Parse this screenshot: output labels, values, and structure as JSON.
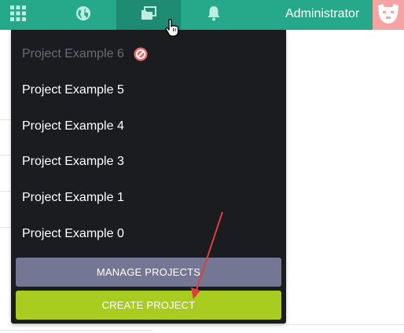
{
  "topbar": {
    "color": "#26a88a",
    "active_color": "#1e8c72",
    "icons": [
      "apps-grid-icon",
      "globe-icon",
      "folder-icon",
      "bell-icon"
    ],
    "user_name": "Administrator",
    "avatar_color": "#f5a3a3"
  },
  "dropdown": {
    "background": "#1b1c20",
    "projects": [
      {
        "label": "Project Example 6",
        "disabled": true
      },
      {
        "label": "Project Example 5",
        "disabled": false
      },
      {
        "label": "Project Example 4",
        "disabled": false
      },
      {
        "label": "Project Example 3",
        "disabled": false
      },
      {
        "label": "Project Example 1",
        "disabled": false
      },
      {
        "label": "Project Example 0",
        "disabled": false
      }
    ],
    "manage_label": "MANAGE PROJECTS",
    "create_label": "CREATE PROJECT",
    "manage_color": "#747793",
    "create_color": "#a8cc1f"
  },
  "annotation": {
    "arrow_color": "#e03c3c"
  }
}
